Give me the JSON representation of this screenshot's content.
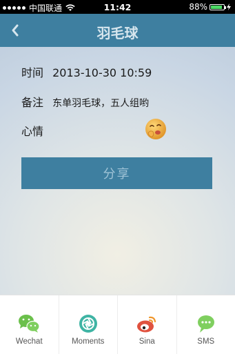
{
  "status_bar": {
    "carrier": "中国联通",
    "time": "11:42",
    "battery": "88%",
    "battery_level": 0.88
  },
  "nav": {
    "title": "羽毛球"
  },
  "details": {
    "time_label": "时间",
    "time_value": "2013-10-30 10:59",
    "note_label": "备注",
    "note_value": "东单羽毛球，五人组哟",
    "mood_label": "心情"
  },
  "share_button": {
    "label": "分享"
  },
  "share_sheet": {
    "items": [
      {
        "label": "Wechat",
        "icon": "wechat-icon",
        "color": "#6bc04b"
      },
      {
        "label": "Moments",
        "icon": "moments-icon",
        "color": "#3fb4a4"
      },
      {
        "label": "Sina",
        "icon": "weibo-icon",
        "color": "#e0523f"
      },
      {
        "label": "SMS",
        "icon": "sms-icon",
        "color": "#7fcf5f"
      }
    ]
  },
  "colors": {
    "accent": "#3e7fa0"
  }
}
